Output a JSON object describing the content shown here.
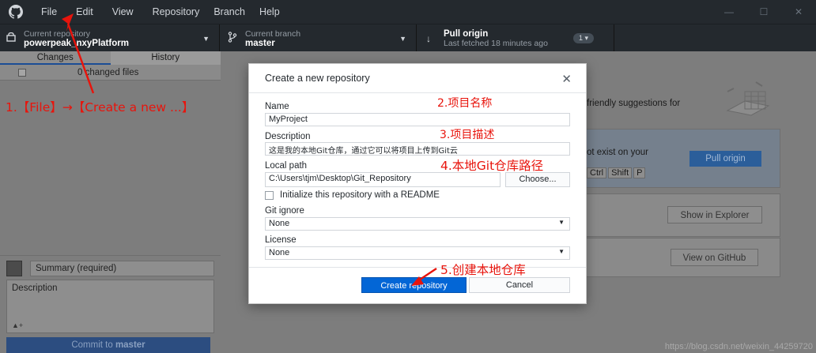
{
  "titlebar": {
    "menu": [
      "File",
      "Edit",
      "View",
      "Repository",
      "Branch",
      "Help"
    ],
    "window_controls": {
      "minimize": "—",
      "maximize": "☐",
      "close": "✕"
    }
  },
  "toolbar": {
    "repo": {
      "sub": "Current repository",
      "main": "powerpeak_nxyPlatform"
    },
    "branch": {
      "sub": "Current branch",
      "main": "master"
    },
    "pull": {
      "main": "Pull origin",
      "sub": "Last fetched 18 minutes ago",
      "badge": "1 ▾"
    }
  },
  "sidebar": {
    "tabs": [
      "Changes",
      "History"
    ],
    "changed_files": "0 changed files",
    "summary_placeholder": "Summary (required)",
    "description_placeholder": "Description",
    "commit_label": "Commit to",
    "commit_branch": "master"
  },
  "main": {
    "suggestions": "friendly suggestions for",
    "not_exist": "ot exist on your",
    "pull_origin": "Pull origin",
    "kbd": [
      "Ctrl",
      "Shift",
      "P"
    ],
    "show_explorer": "Show in Explorer",
    "view_github": "View on GitHub",
    "watermark": "https://blog.csdn.net/weixin_44259720"
  },
  "dialog": {
    "title": "Create a new repository",
    "name_label": "Name",
    "name_value": "MyProject",
    "description_label": "Description",
    "description_value": "这是我的本地Git仓库，通过它可以将项目上传到Git云",
    "local_path_label": "Local path",
    "local_path_value": "C:\\Users\\tjm\\Desktop\\Git_Repository",
    "choose_label": "Choose...",
    "readme_label": "Initialize this repository with a README",
    "gitignore_label": "Git ignore",
    "gitignore_value": "None",
    "license_label": "License",
    "license_value": "None",
    "create_label": "Create repository",
    "cancel_label": "Cancel"
  },
  "annotations": {
    "step1": "1.【File】→【Create a new ...】",
    "step2": "2.项目名称",
    "step3": "3.项目描述",
    "step4": "4.本地Git仓库路径",
    "step5": "5.创建本地仓库",
    "color": "#e8140c"
  },
  "colors": {
    "titlebar": "#24292e",
    "primary_button": "#0366d6",
    "annotation_red": "#e8140c"
  }
}
